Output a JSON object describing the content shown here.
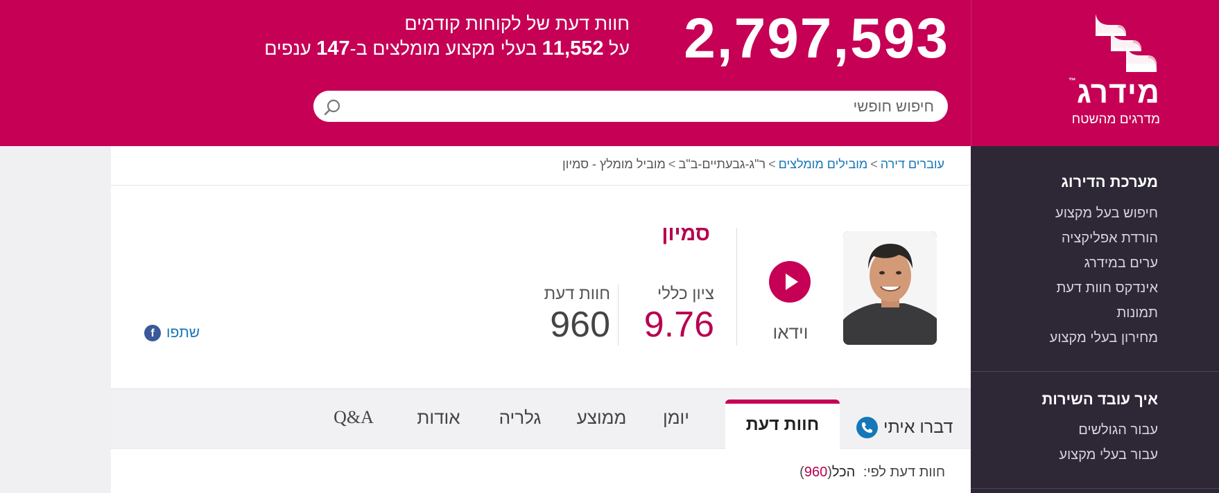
{
  "header": {
    "brand_name": "מידרג",
    "brand_tm": "™",
    "brand_subtitle": "מדרגים מהשטח",
    "total_reviews": "2,797,593",
    "tagline_line1": "חוות דעת של לקוחות קודמים",
    "tagline_prefix": "על",
    "pros_count": "11,552",
    "tagline_middle": "בעלי מקצוע מומלצים ב-",
    "categories_count": "147",
    "tagline_suffix": "ענפים",
    "search_placeholder": "חיפוש חופשי"
  },
  "sidebar": {
    "section1_title": "מערכת הדירוג",
    "section1_links": [
      "חיפוש בעל מקצוע",
      "הורדת אפליקציה",
      "ערים במידרג",
      "אינדקס חוות דעת",
      "תמונות",
      "מחירון בעלי מקצוע"
    ],
    "section2_title": "איך עובד השירות",
    "section2_links": [
      "עבור הגולשים",
      "עבור בעלי מקצוע"
    ]
  },
  "breadcrumb": {
    "items": [
      "עוברים דירה",
      "מובילים מומלצים",
      "ר\"ג-גבעתיים-ב\"ב",
      "מוביל מומלץ - סמיון"
    ],
    "separator": ">"
  },
  "profile": {
    "name": "סמיון",
    "video_label": "וידאו",
    "score_label": "ציון כללי",
    "score_value": "9.76",
    "reviews_label": "חוות דעת",
    "reviews_value": "960",
    "share_label": "שתפו",
    "facebook_glyph": "f"
  },
  "tabs": {
    "contact": "דברו איתי",
    "items": [
      "חוות דעת",
      "יומן",
      "ממוצע",
      "גלריה",
      "אודות",
      "Q&A"
    ],
    "active_index": 0
  },
  "filter": {
    "label": "חוות דעת לפי:",
    "selected": "הכל",
    "open_paren": "(",
    "count": "960",
    "close_paren": ")"
  },
  "colors": {
    "brand": "#c50055",
    "sidebar_bg": "#2e2836",
    "link": "#1577b8"
  }
}
